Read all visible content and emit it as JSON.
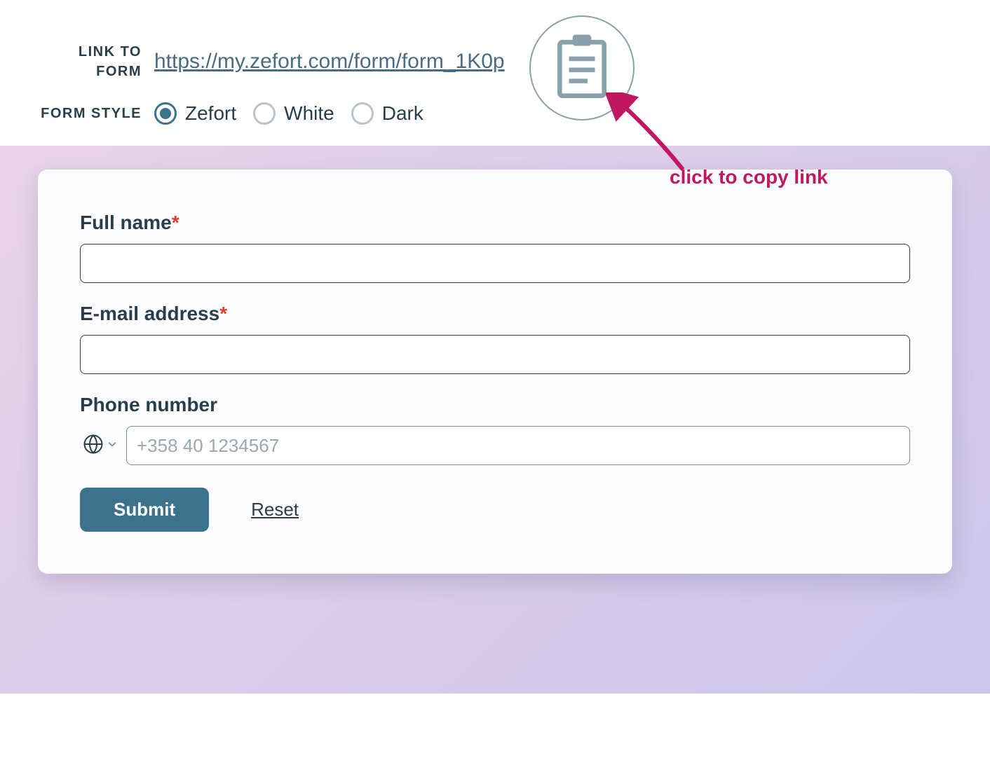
{
  "settings": {
    "link_label": "LINK TO FORM",
    "link_url": "https://my.zefort.com/form/form_1K0p",
    "style_label": "FORM STYLE",
    "styles": {
      "zefort": "Zefort",
      "white": "White",
      "dark": "Dark"
    }
  },
  "annotation": {
    "text": "click to copy link"
  },
  "form": {
    "fields": {
      "fullname": {
        "label": "Full name",
        "required": "*"
      },
      "email": {
        "label": "E-mail address",
        "required": "*"
      },
      "phone": {
        "label": "Phone number",
        "placeholder": "+358 40 1234567"
      }
    },
    "submit": "Submit",
    "reset": "Reset"
  }
}
